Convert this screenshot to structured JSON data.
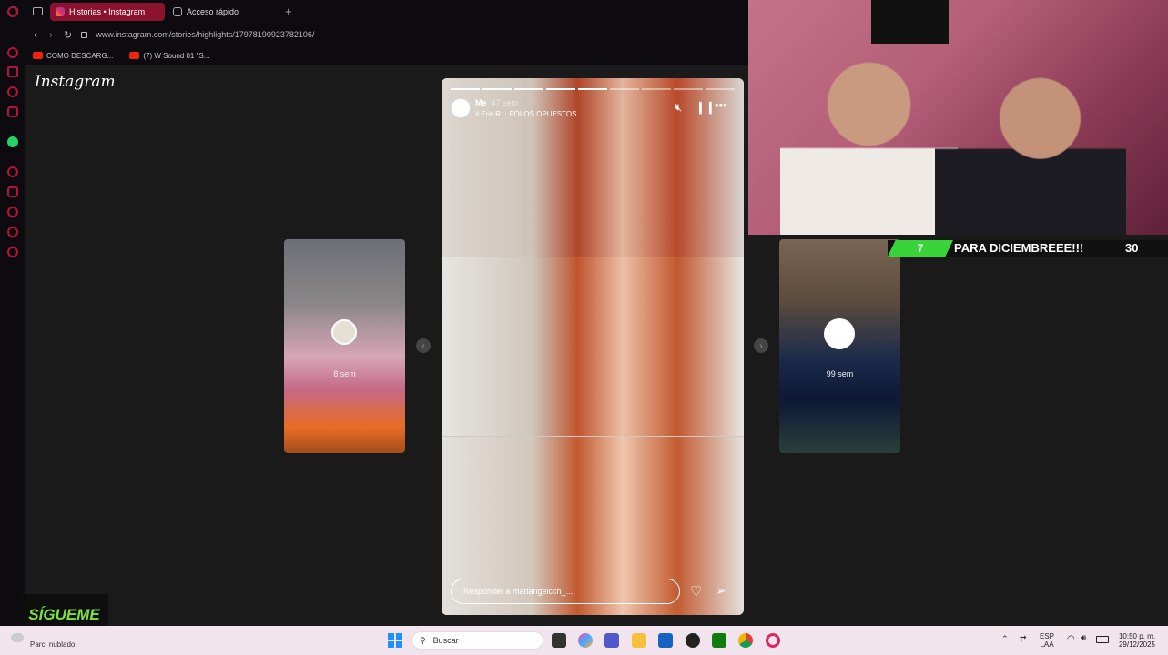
{
  "browser": {
    "tabs": [
      {
        "label": "Historias • Instagram",
        "active": true
      },
      {
        "label": "Acceso rápido",
        "active": false
      }
    ],
    "url": "www.instagram.com/stories/highlights/17978190923782106/",
    "bookmarks": [
      {
        "label": "COMO DESCARG..."
      },
      {
        "label": "(7) W Sound 01 \"S..."
      }
    ]
  },
  "instagram": {
    "logo": "Instagram",
    "prev_story": {
      "time": "8 sem"
    },
    "next_story": {
      "time": "99 sem"
    },
    "story": {
      "user": "Me",
      "time": "47 sem",
      "song": "Eris R. · POLOS OPUESTOS",
      "reply_placeholder": "Responder a mariangelcch_..."
    }
  },
  "overlay": {
    "banner_badge": "7",
    "banner_text": "PARA DICIEMBREEE!!!",
    "banner_count": "30",
    "follow_text": "SÍGUEME"
  },
  "taskbar": {
    "weather": "Parc. nublado",
    "search_placeholder": "Buscar",
    "lang_top": "ESP",
    "lang_bottom": "LAA",
    "time": "10:50 p. m.",
    "date": "29/12/2025"
  },
  "colors": {
    "accent": "#8b1330",
    "banner_green": "#39d33a"
  }
}
